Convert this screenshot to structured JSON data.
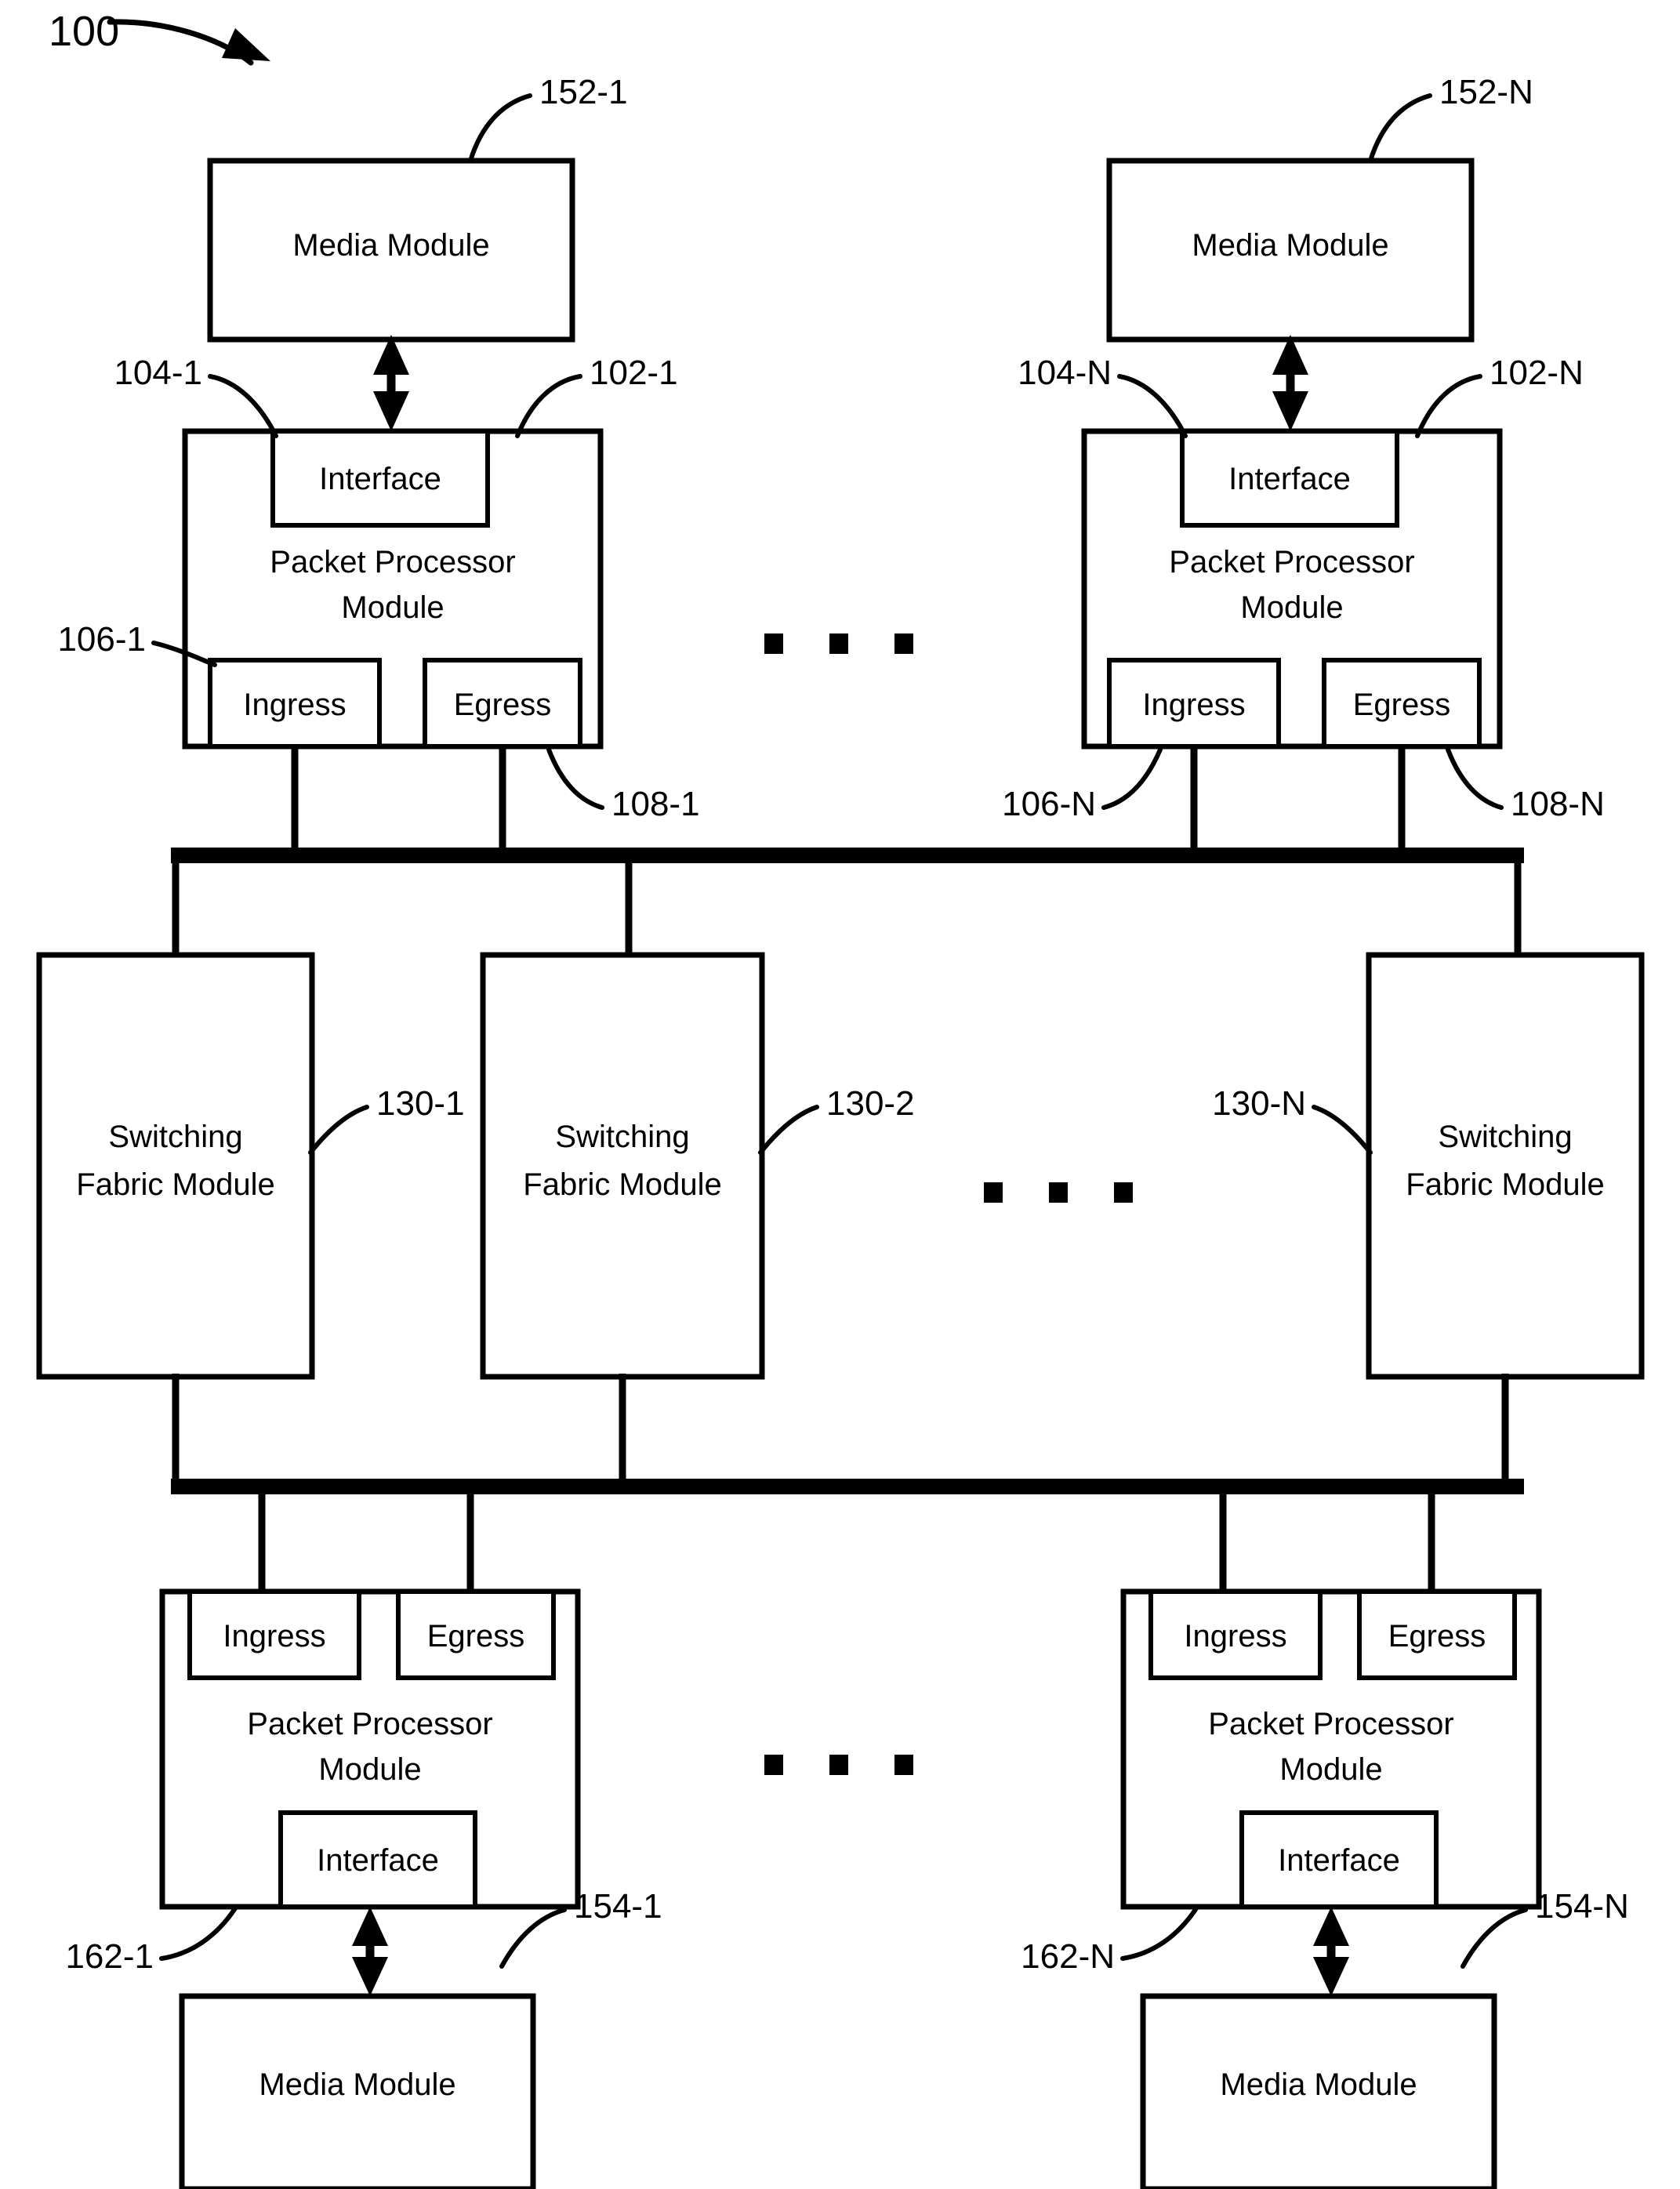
{
  "figure": {
    "number": "100",
    "pointer_icon": "curved-arrow-icon"
  },
  "labels": {
    "media_module": "Media Module",
    "packet_processor_module_line1": "Packet Processor",
    "packet_processor_module_line2": "Module",
    "interface": "Interface",
    "ingress": "Ingress",
    "egress": "Egress",
    "switching_fabric_line1": "Switching",
    "switching_fabric_line2": "Fabric Module",
    "ellipsis": "▪  ▪  ▪"
  },
  "reference_numerals": {
    "media_top_left": "152-1",
    "media_top_right": "152-N",
    "interface_top_left": "104-1",
    "packet_processor_top_left": "102-1",
    "interface_top_right": "104-N",
    "packet_processor_top_right": "102-N",
    "ingress_top_left": "106-1",
    "egress_top_left": "108-1",
    "ingress_top_right": "106-N",
    "egress_top_right": "108-N",
    "switching_fabric_1": "130-1",
    "switching_fabric_2": "130-2",
    "switching_fabric_n": "130-N",
    "packet_processor_bottom_left": "162-1",
    "media_bottom_left": "154-1",
    "packet_processor_bottom_right": "162-N",
    "media_bottom_right": "154-N"
  },
  "blocks": {
    "top_row_media": [
      {
        "id": "media-top-1",
        "label": "Media Module",
        "ref": "152-1"
      },
      {
        "id": "media-top-n",
        "label": "Media Module",
        "ref": "152-N"
      }
    ],
    "top_row_packet_processors": [
      {
        "id": "ppm-top-1",
        "label_line1": "Packet Processor",
        "label_line2": "Module",
        "ref": "102-1",
        "interface": {
          "label": "Interface",
          "ref": "104-1"
        },
        "ingress": {
          "label": "Ingress",
          "ref": "106-1"
        },
        "egress": {
          "label": "Egress",
          "ref": "108-1"
        }
      },
      {
        "id": "ppm-top-n",
        "label_line1": "Packet Processor",
        "label_line2": "Module",
        "ref": "102-N",
        "interface": {
          "label": "Interface",
          "ref": "104-N"
        },
        "ingress": {
          "label": "Ingress",
          "ref": "106-N"
        },
        "egress": {
          "label": "Egress",
          "ref": "108-N"
        }
      }
    ],
    "switching_fabric_modules": [
      {
        "id": "sfm-1",
        "label_line1": "Switching",
        "label_line2": "Fabric Module",
        "ref": "130-1"
      },
      {
        "id": "sfm-2",
        "label_line1": "Switching",
        "label_line2": "Fabric Module",
        "ref": "130-2"
      },
      {
        "id": "sfm-n",
        "label_line1": "Switching",
        "label_line2": "Fabric Module",
        "ref": "130-N"
      }
    ],
    "bottom_row_packet_processors": [
      {
        "id": "ppm-bot-1",
        "label_line1": "Packet Processor",
        "label_line2": "Module",
        "ref": "162-1",
        "interface": {
          "label": "Interface"
        },
        "ingress": {
          "label": "Ingress"
        },
        "egress": {
          "label": "Egress"
        }
      },
      {
        "id": "ppm-bot-n",
        "label_line1": "Packet Processor",
        "label_line2": "Module",
        "ref": "162-N",
        "interface": {
          "label": "Interface"
        },
        "ingress": {
          "label": "Ingress"
        },
        "egress": {
          "label": "Egress"
        }
      }
    ],
    "bottom_row_media": [
      {
        "id": "media-bot-1",
        "label": "Media Module",
        "ref": "154-1"
      },
      {
        "id": "media-bot-n",
        "label": "Media Module",
        "ref": "154-N"
      }
    ]
  },
  "colors": {
    "stroke": "#000000",
    "fill": "#ffffff",
    "background": "#ffffff"
  }
}
